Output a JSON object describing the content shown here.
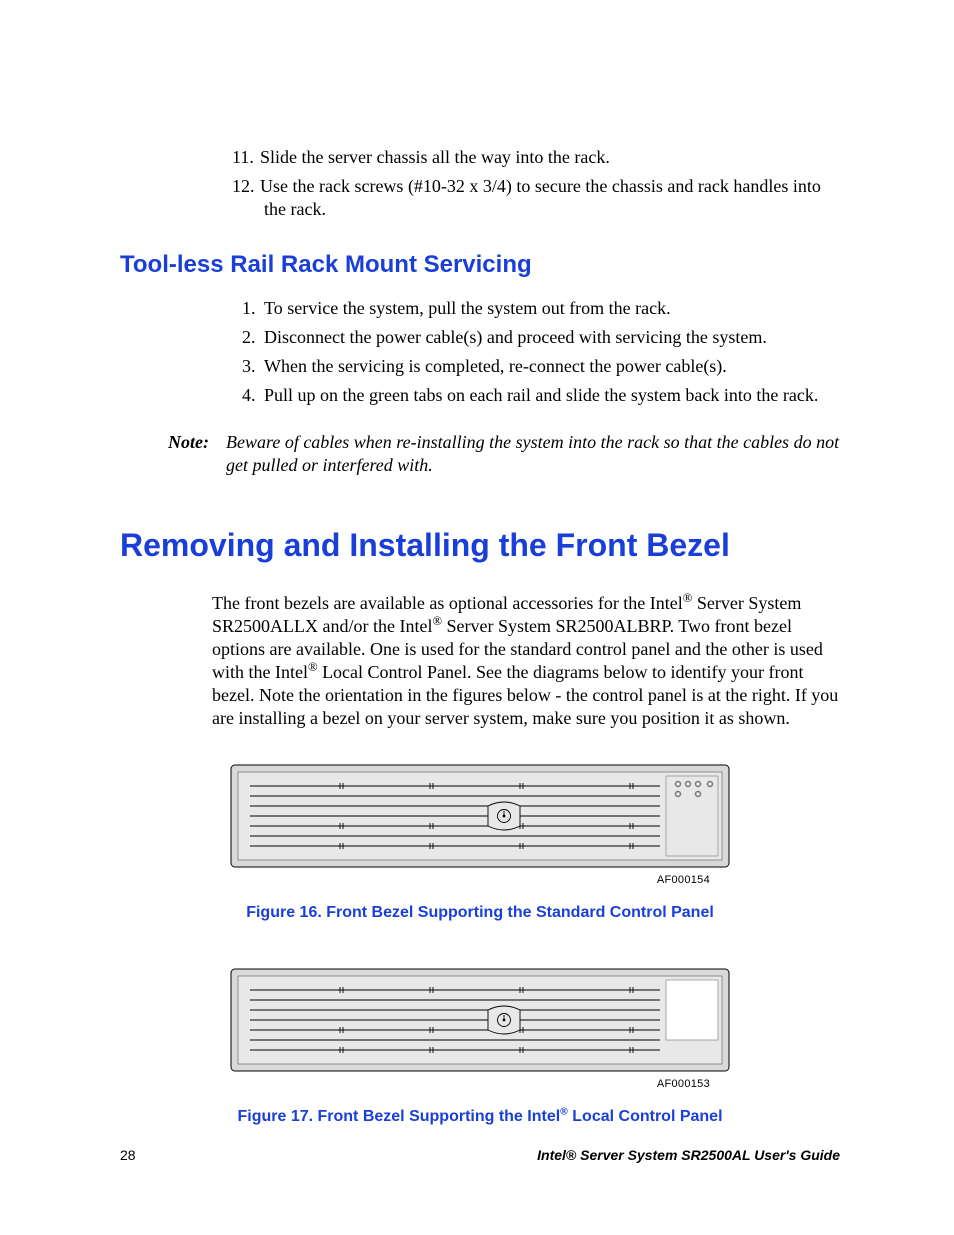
{
  "list_a": {
    "items": [
      "Slide the server chassis all the way into the rack.",
      "Use the rack screws (#10-32 x 3/4) to secure the chassis and rack handles into the rack."
    ]
  },
  "heading_servicing": "Tool-less Rail Rack Mount Servicing",
  "list_b": {
    "items": [
      "To service the system, pull the system out from the rack.",
      "Disconnect the power cable(s) and proceed with servicing the system.",
      "When the servicing is completed, re-connect the power cable(s).",
      "Pull up on the green tabs on each rail and slide the system back into the rack."
    ]
  },
  "note": {
    "label": "Note:",
    "text": "Beware of cables when re-installing the system into the rack so that the cables do not get pulled or interfered with."
  },
  "heading_bezel": "Removing and Installing the Front Bezel",
  "body_para_html": "The front bezels are available as optional accessories for the Intel<sup>®</sup> Server System SR2500ALLX and/or the Intel<sup>®</sup> Server System SR2500ALBRP. Two front bezel options are available. One is used for the standard control panel and the other is used with the Intel<sup>®</sup> Local Control Panel. See the diagrams below to identify your front bezel. Note the orientation in the figures below - the control panel is at the right. If you are installing a bezel on your server system, make sure you position it as shown.",
  "figure1": {
    "id": "AF000154",
    "caption": "Figure 16. Front Bezel Supporting the Standard Control Panel"
  },
  "figure2": {
    "id": "AF000153",
    "caption_pre": "Figure 17. Front Bezel Supporting the Intel",
    "caption_post": " Local Control Panel"
  },
  "footer": {
    "page": "28",
    "title": "Intel® Server System SR2500AL User's Guide"
  }
}
